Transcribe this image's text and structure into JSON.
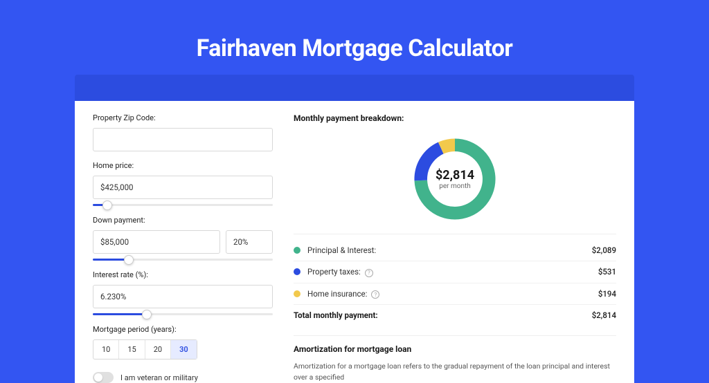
{
  "title": "Fairhaven Mortgage Calculator",
  "form": {
    "zip": {
      "label": "Property Zip Code:",
      "value": ""
    },
    "price": {
      "label": "Home price:",
      "value": "$425,000",
      "slider_pct": 8
    },
    "down": {
      "label": "Down payment:",
      "value": "$85,000",
      "pct": "20%",
      "slider_pct": 20
    },
    "rate": {
      "label": "Interest rate (%):",
      "value": "6.230%",
      "slider_pct": 30
    },
    "period": {
      "label": "Mortgage period (years):",
      "options": [
        "10",
        "15",
        "20",
        "30"
      ],
      "active": "30"
    },
    "veteran": {
      "label": "I am veteran or military"
    }
  },
  "breakdown": {
    "title": "Monthly payment breakdown:",
    "center_value": "$2,814",
    "center_label": "per month",
    "rows": [
      {
        "color": "#41B38C",
        "name": "Principal & Interest:",
        "value": "$2,089",
        "info": false
      },
      {
        "color": "#2C4CE0",
        "name": "Property taxes:",
        "value": "$531",
        "info": true
      },
      {
        "color": "#F2C94C",
        "name": "Home insurance:",
        "value": "$194",
        "info": true
      }
    ],
    "total": {
      "name": "Total monthly payment:",
      "value": "$2,814"
    }
  },
  "chart_data": {
    "type": "pie",
    "title": "Monthly payment breakdown",
    "series": [
      {
        "name": "Principal & Interest",
        "value": 2089,
        "color": "#41B38C"
      },
      {
        "name": "Property taxes",
        "value": 531,
        "color": "#2C4CE0"
      },
      {
        "name": "Home insurance",
        "value": 194,
        "color": "#F2C94C"
      }
    ],
    "total": 2814
  },
  "amort": {
    "title": "Amortization for mortgage loan",
    "text": "Amortization for a mortgage loan refers to the gradual repayment of the loan principal and interest over a specified"
  }
}
